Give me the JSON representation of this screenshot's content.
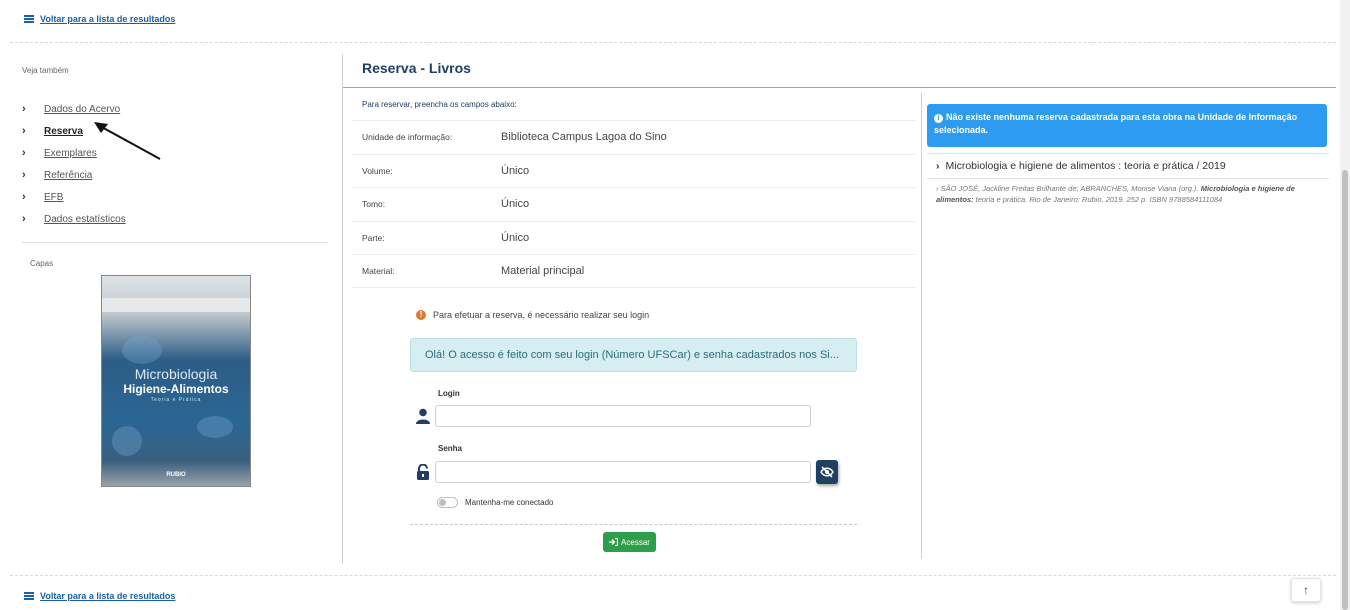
{
  "back_link": {
    "label": "Voltar para a lista de resultados"
  },
  "sidebar": {
    "see_also": "Veja também",
    "items": [
      {
        "label": "Dados do Acervo",
        "active": false
      },
      {
        "label": "Reserva",
        "active": true
      },
      {
        "label": "Exemplares",
        "active": false
      },
      {
        "label": "Referência",
        "active": false
      },
      {
        "label": "EFB",
        "active": false
      },
      {
        "label": "Dados estatísticos",
        "active": false
      }
    ],
    "covers_label": "Capas",
    "cover": {
      "title_line1": "Microbiologia",
      "title_line2": "Higiene-Alimentos",
      "subtitle": "Teoria e Prática",
      "publisher": "RUBIO"
    }
  },
  "main": {
    "title": "Reserva - Livros",
    "instructions": "Para reservar, preencha os campos abaixo:",
    "fields": [
      {
        "label": "Unidade de informação:",
        "value": "Biblioteca Campus Lagoa do Sino"
      },
      {
        "label": "Volume:",
        "value": "Único"
      },
      {
        "label": "Tomo:",
        "value": "Único"
      },
      {
        "label": "Parte:",
        "value": "Único"
      },
      {
        "label": "Material:",
        "value": "Material principal"
      }
    ],
    "login_note": "Para efetuar a reserva, é necessário realizar seu login",
    "info_box": "Olá! O acesso é feito com seu login (Número UFSCar) e senha cadastrados nos Si...",
    "login_label": "Login",
    "login_value": "",
    "password_label": "Senha",
    "password_value": "",
    "remember_label": "Mantenha-me conectado",
    "submit_label": "Acessar"
  },
  "right": {
    "alert": "Não existe nenhuma reserva cadastrada para esta obra na Unidade de Informação selecionada.",
    "work_title": "Microbiologia e higiene de alimentos : teoria e prática / 2019",
    "reference_plain": "SÃO JOSÉ, Jackline Freitas Brilhante de; ABRANCHES, Monise Viana (org.).",
    "reference_bold": "Microbiologia e higiene de alimentos:",
    "reference_rest": "teoria e prática. Rio de Janeiro: Rubio, 2019. 252 p. ISBN 9788584111084"
  },
  "colors": {
    "brand": "#1f3f63",
    "link": "#1a5fa8",
    "alert_blue": "#2d9bf0",
    "info_bg": "#d6eef2",
    "success": "#2f9e4a",
    "warning": "#e07a2e"
  },
  "icons": {
    "list": "list-icon",
    "chevron": "chevron-right-icon",
    "user": "user-icon",
    "lock": "unlock-icon",
    "eye": "eye-slash-icon",
    "login": "sign-in-icon",
    "info": "info-circle-icon",
    "warning": "exclamation-circle-icon",
    "to_top": "arrow-up-icon"
  }
}
